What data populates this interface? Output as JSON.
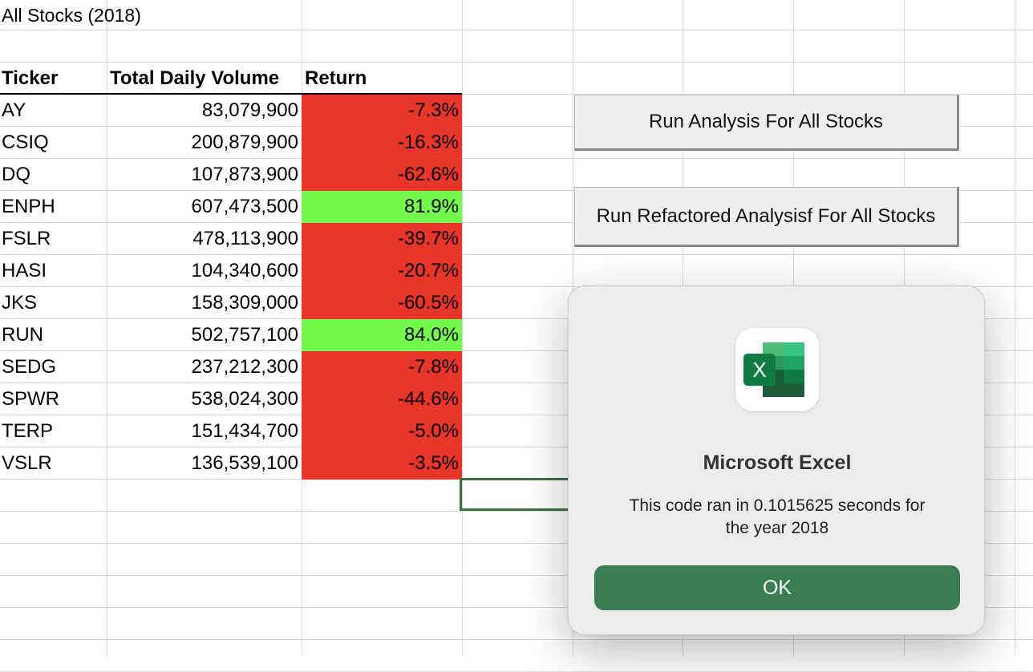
{
  "sheet": {
    "title": "All Stocks (2018)",
    "headers": {
      "ticker": "Ticker",
      "volume": "Total Daily Volume",
      "return": "Return"
    },
    "rows": [
      {
        "ticker": "AY",
        "volume": "83,079,900",
        "return": "-7.3%",
        "positive": false
      },
      {
        "ticker": "CSIQ",
        "volume": "200,879,900",
        "return": "-16.3%",
        "positive": false
      },
      {
        "ticker": "DQ",
        "volume": "107,873,900",
        "return": "-62.6%",
        "positive": false
      },
      {
        "ticker": "ENPH",
        "volume": "607,473,500",
        "return": "81.9%",
        "positive": true
      },
      {
        "ticker": "FSLR",
        "volume": "478,113,900",
        "return": "-39.7%",
        "positive": false
      },
      {
        "ticker": "HASI",
        "volume": "104,340,600",
        "return": "-20.7%",
        "positive": false
      },
      {
        "ticker": "JKS",
        "volume": "158,309,000",
        "return": "-60.5%",
        "positive": false
      },
      {
        "ticker": "RUN",
        "volume": "502,757,100",
        "return": "84.0%",
        "positive": true
      },
      {
        "ticker": "SEDG",
        "volume": "237,212,300",
        "return": "-7.8%",
        "positive": false
      },
      {
        "ticker": "SPWR",
        "volume": "538,024,300",
        "return": "-44.6%",
        "positive": false
      },
      {
        "ticker": "TERP",
        "volume": "151,434,700",
        "return": "-5.0%",
        "positive": false
      },
      {
        "ticker": "VSLR",
        "volume": "136,539,100",
        "return": "-3.5%",
        "positive": false
      }
    ]
  },
  "buttons": {
    "run_analysis": "Run Analysis For All Stocks",
    "run_refactored": "Run Refactored Analysisf For All Stocks"
  },
  "dialog": {
    "title": "Microsoft Excel",
    "message_line1": "This code ran in 0.1015625 seconds for",
    "message_line2": "the year 2018",
    "ok_label": "OK",
    "icon": "excel-app-icon",
    "icon_letter": "X"
  },
  "colors": {
    "negative_fill": "#e8352a",
    "positive_fill": "#74f94e",
    "ok_button": "#3b7d52",
    "excel_green": "#217346"
  }
}
